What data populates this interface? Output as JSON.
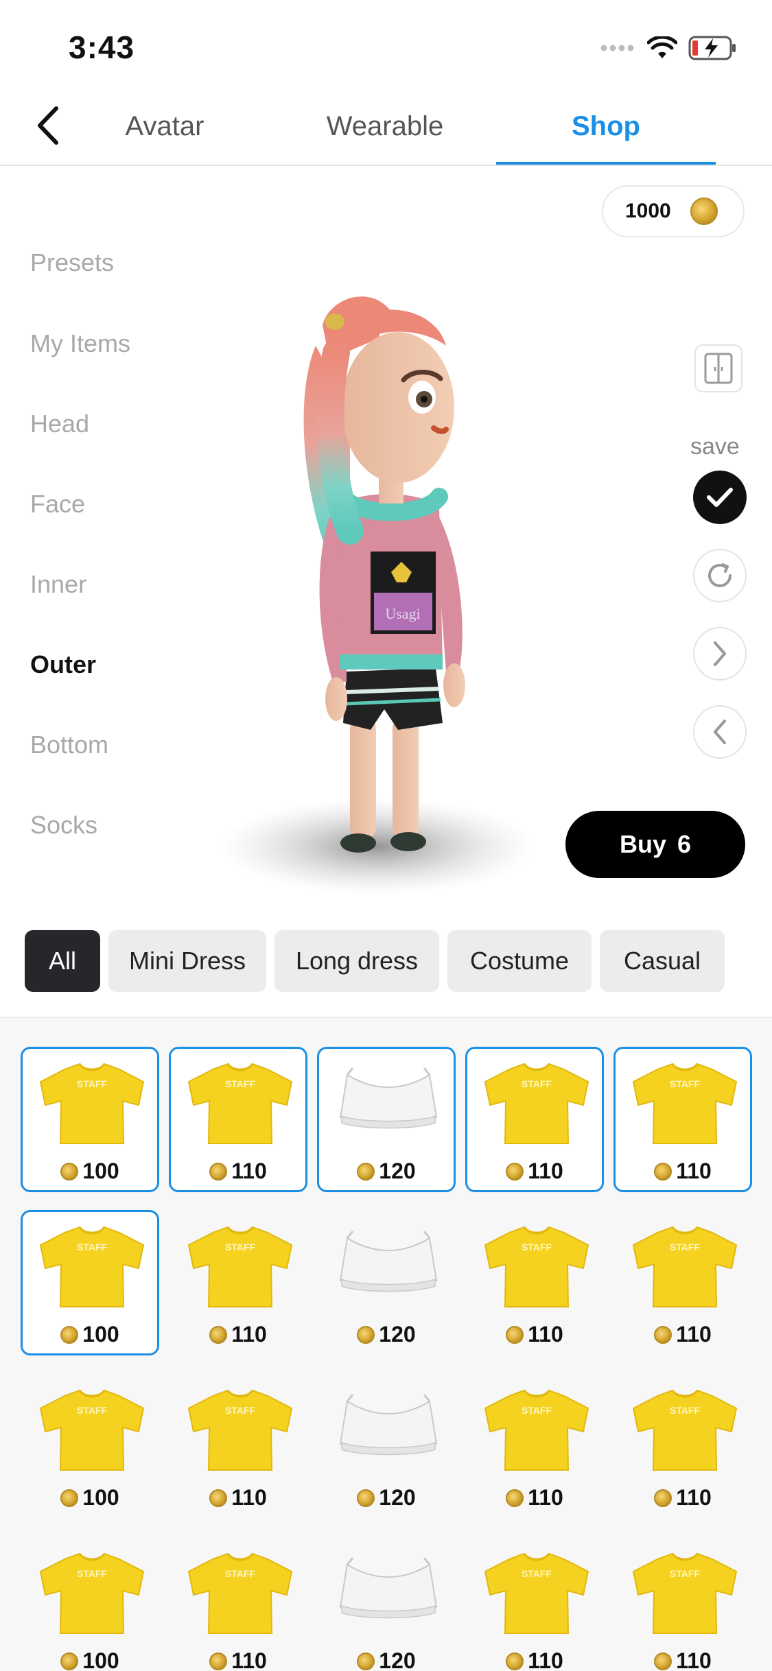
{
  "status_bar": {
    "time": "3:43"
  },
  "nav": {
    "tabs": [
      {
        "label": "Avatar"
      },
      {
        "label": "Wearable"
      },
      {
        "label": "Shop"
      }
    ]
  },
  "coins": {
    "balance": "1000"
  },
  "categories": [
    {
      "label": "Presets"
    },
    {
      "label": "My Items"
    },
    {
      "label": "Head"
    },
    {
      "label": "Face"
    },
    {
      "label": "Inner"
    },
    {
      "label": "Outer"
    },
    {
      "label": "Bottom"
    },
    {
      "label": "Socks"
    }
  ],
  "tools": {
    "save_label": "save"
  },
  "buy": {
    "label": "Buy",
    "count": "6"
  },
  "filters": [
    {
      "label": "All"
    },
    {
      "label": "Mini Dress"
    },
    {
      "label": "Long dress"
    },
    {
      "label": "Costume"
    },
    {
      "label": "Casual"
    }
  ],
  "items": [
    {
      "kind": "tshirt",
      "price": "100",
      "selected": true
    },
    {
      "kind": "tshirt",
      "price": "110",
      "selected": true
    },
    {
      "kind": "croptop",
      "price": "120",
      "selected": true
    },
    {
      "kind": "tshirt",
      "price": "110",
      "selected": true
    },
    {
      "kind": "tshirt",
      "price": "110",
      "selected": true
    },
    {
      "kind": "tshirt",
      "price": "100",
      "selected": true
    },
    {
      "kind": "tshirt",
      "price": "110",
      "selected": false
    },
    {
      "kind": "croptop",
      "price": "120",
      "selected": false
    },
    {
      "kind": "tshirt",
      "price": "110",
      "selected": false
    },
    {
      "kind": "tshirt",
      "price": "110",
      "selected": false
    },
    {
      "kind": "tshirt",
      "price": "100",
      "selected": false
    },
    {
      "kind": "tshirt",
      "price": "110",
      "selected": false
    },
    {
      "kind": "croptop",
      "price": "120",
      "selected": false
    },
    {
      "kind": "tshirt",
      "price": "110",
      "selected": false
    },
    {
      "kind": "tshirt",
      "price": "110",
      "selected": false
    },
    {
      "kind": "tshirt",
      "price": "100",
      "selected": false
    },
    {
      "kind": "tshirt",
      "price": "110",
      "selected": false
    },
    {
      "kind": "croptop",
      "price": "120",
      "selected": false
    },
    {
      "kind": "tshirt",
      "price": "110",
      "selected": false
    },
    {
      "kind": "tshirt",
      "price": "110",
      "selected": false
    }
  ],
  "tshirt_print": "STAFF",
  "hoodie_print": "Usagi",
  "colors": {
    "accent": "#1b8fe6",
    "chip_active": "#26272b",
    "coin_gold": "#d4a52f",
    "tshirt_yellow": "#f5d21f"
  }
}
